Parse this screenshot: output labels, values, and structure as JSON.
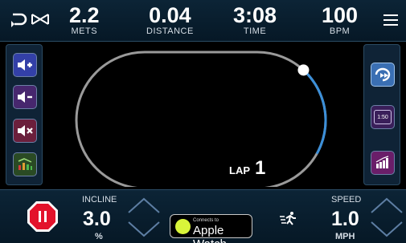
{
  "metrics": {
    "mets": {
      "value": "2.2",
      "label": "METS"
    },
    "distance": {
      "value": "0.04",
      "label": "DISTANCE"
    },
    "time": {
      "value": "3:08",
      "label": "TIME"
    },
    "bpm": {
      "value": "100",
      "label": "BPM"
    }
  },
  "left_buttons": [
    "volume-up-icon",
    "volume-down-icon",
    "mute-icon",
    "workout-profile-icon"
  ],
  "right_buttons": [
    "repeat-icon",
    "timer-icon",
    "bar-chart-icon"
  ],
  "timer_label": "1:50",
  "lap": {
    "label": "LAP",
    "number": "1",
    "progress": 0.14
  },
  "incline": {
    "label": "INCLINE",
    "value": "3.0",
    "unit": "%"
  },
  "speed": {
    "label": "SPEED",
    "value": "1.0",
    "unit": "MPH"
  },
  "apple_watch": {
    "small": "Connects to",
    "big": "Apple Watch"
  },
  "colors": {
    "accent": "#3b8fd9",
    "track": "#9a9a9a",
    "panel": "#0f2336",
    "stop": "#e3122b"
  }
}
